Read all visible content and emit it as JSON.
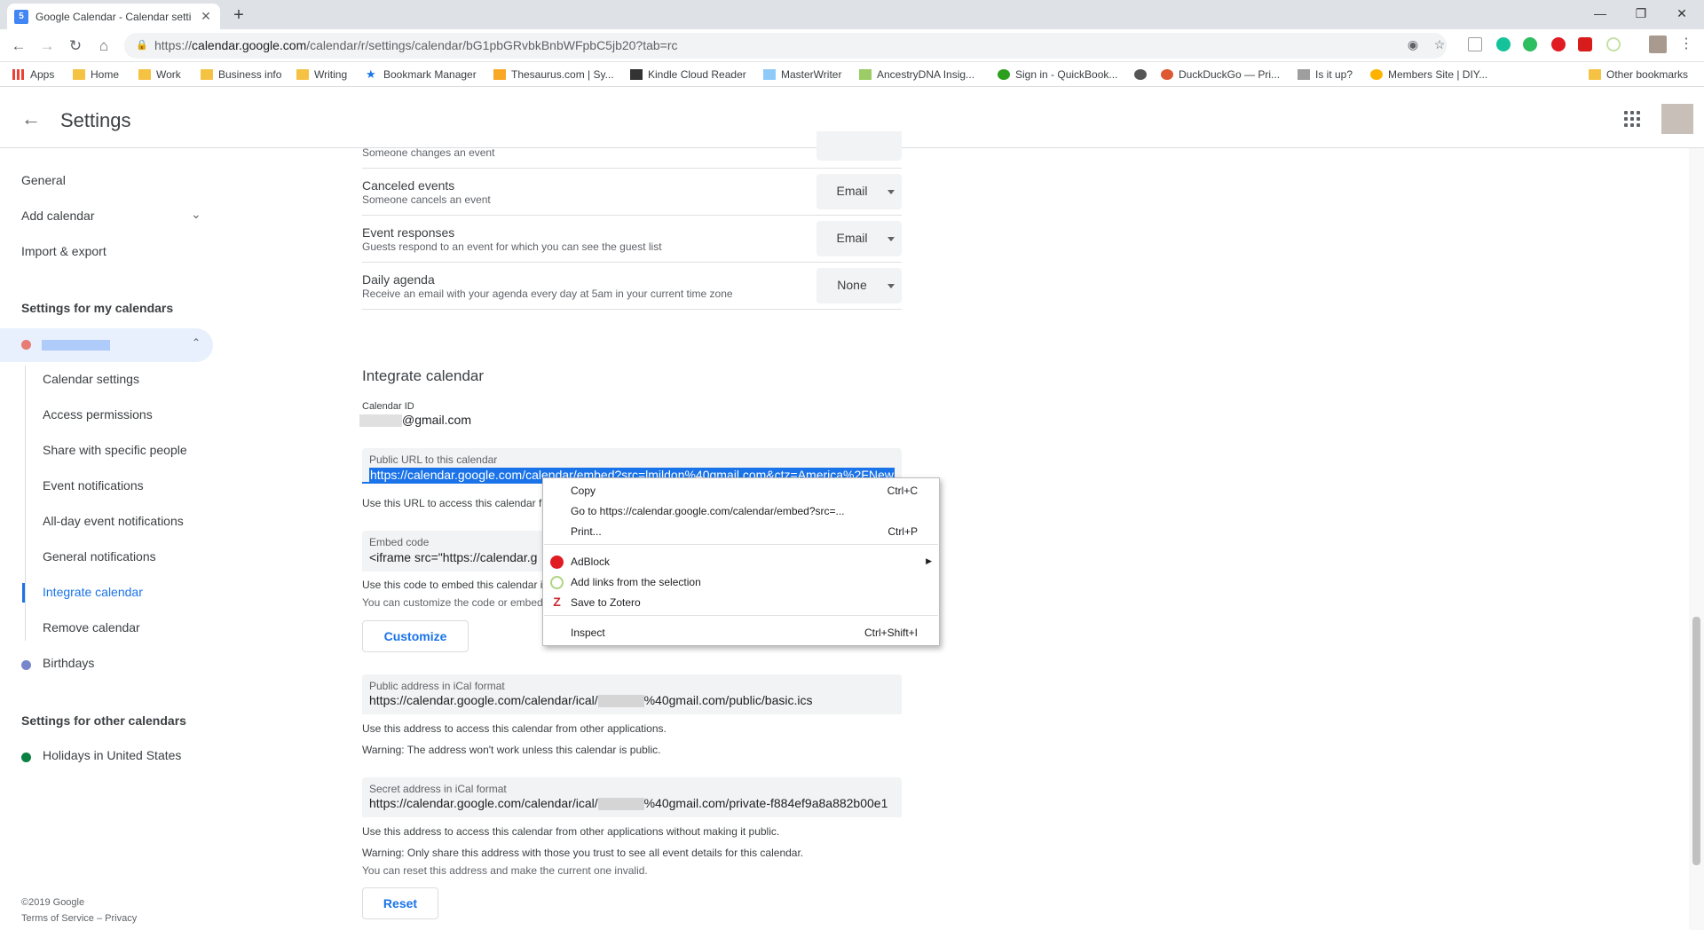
{
  "browser": {
    "tab_title": "Google Calendar - Calendar setti",
    "tab_favicon": "5",
    "url_prefix": "https://",
    "url_host": "calendar.google.com",
    "url_path": "/calendar/r/settings/calendar/bG1pbGRvbkBnbWFpbC5jb20?tab=rc",
    "bookmarks": [
      "Apps",
      "Home",
      "Work",
      "Business info",
      "Writing",
      "Bookmark Manager",
      "Thesaurus.com | Sy...",
      "Kindle Cloud Reader",
      "MasterWriter",
      "AncestryDNA Insig...",
      "Sign in - QuickBook...",
      "DuckDuckGo — Pri...",
      "Is it up?",
      "Members Site | DIY..."
    ],
    "other_bookmarks": "Other bookmarks"
  },
  "header": {
    "title": "Settings"
  },
  "sidebar": {
    "general": "General",
    "add_calendar": "Add calendar",
    "import_export": "Import & export",
    "my_calendars_heading": "Settings for my calendars",
    "sub_items": [
      "Calendar settings",
      "Access permissions",
      "Share with specific people",
      "Event notifications",
      "All-day event notifications",
      "General notifications",
      "Integrate calendar",
      "Remove calendar"
    ],
    "birthdays": "Birthdays",
    "other_calendars_heading": "Settings for other calendars",
    "holidays": "Holidays in United States",
    "copyright": "©2019 Google",
    "terms": "Terms of Service",
    "dash": "–",
    "privacy": "Privacy",
    "colors": {
      "my_calendar": "#e67c73",
      "birthdays": "#7986cb",
      "holidays": "#0b8043",
      "active": "#1a73e8"
    }
  },
  "notifications": {
    "changed_sub": "Someone changes an event",
    "rows": [
      {
        "title": "Canceled events",
        "sub": "Someone cancels an event",
        "value": "Email"
      },
      {
        "title": "Event responses",
        "sub": "Guests respond to an event for which you can see the guest list",
        "value": "Email"
      },
      {
        "title": "Daily agenda",
        "sub": "Receive an email with your agenda every day at 5am in your current time zone",
        "value": "None"
      }
    ]
  },
  "integrate": {
    "heading": "Integrate calendar",
    "calendar_id_label": "Calendar ID",
    "calendar_id_suffix": "@gmail.com",
    "public_url_label": "Public URL to this calendar",
    "public_url_value": "https://calendar.google.com/calendar/embed?src=lmildon%40gmail.com&ctz=America%2FNew",
    "public_url_help": "Use this URL to access this calendar f",
    "embed_label": "Embed code",
    "embed_value": "<iframe src=\"https://calendar.g",
    "embed_help1": "Use this code to embed this calendar i",
    "embed_help2": "You can customize the code or embed",
    "customize_button": "Customize",
    "ical_public_label": "Public address in iCal format",
    "ical_public_prefix": "https://calendar.google.com/calendar/ical/",
    "ical_public_suffix": "%40gmail.com/public/basic.ics",
    "ical_public_help1": "Use this address to access this calendar from other applications.",
    "ical_public_help2": "Warning: The address won't work unless this calendar is public.",
    "ical_secret_label": "Secret address in iCal format",
    "ical_secret_prefix": "https://calendar.google.com/calendar/ical/",
    "ical_secret_suffix": "%40gmail.com/private-f884ef9a8a882b00e1",
    "ical_secret_help1": "Use this address to access this calendar from other applications without making it public.",
    "ical_secret_help2": "Warning: Only share this address with those you trust to see all event details for this calendar.",
    "ical_secret_help3": "You can reset this address and make the current one invalid.",
    "reset_button": "Reset"
  },
  "context_menu": {
    "items": [
      {
        "label": "Copy",
        "shortcut": "Ctrl+C"
      },
      {
        "label": "Go to https://calendar.google.com/calendar/embed?src=...",
        "shortcut": ""
      },
      {
        "label": "Print...",
        "shortcut": "Ctrl+P"
      },
      {
        "label": "AdBlock",
        "shortcut": ""
      },
      {
        "label": "Add links from the selection",
        "shortcut": ""
      },
      {
        "label": "Save to Zotero",
        "shortcut": ""
      },
      {
        "label": "Inspect",
        "shortcut": "Ctrl+Shift+I"
      }
    ]
  },
  "theme": {
    "selection": "#1a73e8",
    "link": "#1a73e8"
  }
}
